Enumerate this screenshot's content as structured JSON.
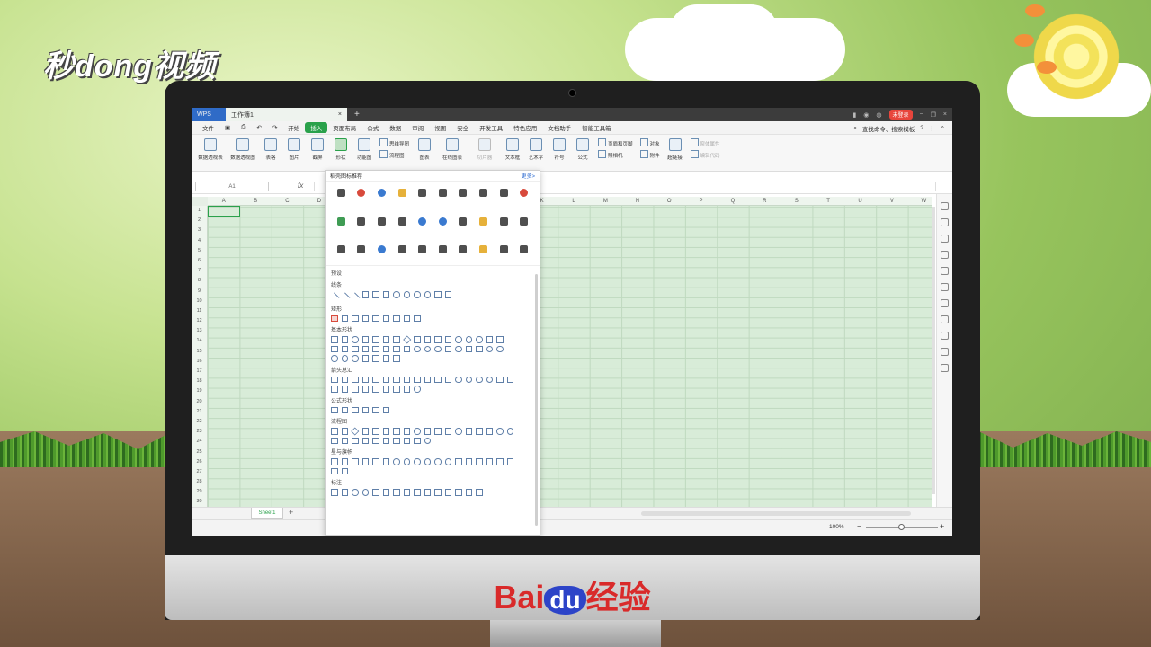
{
  "overlay": {
    "logo_text": "秒dong视频",
    "footer_brand_left": "Bai",
    "footer_brand_mid": "du",
    "footer_brand_right": "经验"
  },
  "window": {
    "app_tab": "WPS",
    "doc_tab": "工作簿1",
    "close_tab": "×",
    "new_tab": "+",
    "login_label": "未登录"
  },
  "menu": {
    "file": "文件",
    "items": [
      "开始",
      "插入",
      "页面布局",
      "公式",
      "数据",
      "审阅",
      "视图",
      "安全",
      "开发工具",
      "特色应用",
      "文档助手",
      "智能工具箱"
    ],
    "active_index": 1,
    "search_placeholder": "查找命令、搜索模板"
  },
  "ribbon": {
    "buttons": [
      "数据透视表",
      "数据透视图",
      "表格",
      "图片",
      "截屏",
      "形状",
      "功能图"
    ],
    "col1": [
      "思维导图",
      "流程图"
    ],
    "col2": [
      "图表",
      "在线图表"
    ],
    "disabled_label": "切片器",
    "text_buttons": [
      "文本框",
      "艺术字",
      "符号",
      "公式"
    ],
    "col3": [
      "页眉和页脚",
      "照相机"
    ],
    "col4": [
      "对象",
      "附件"
    ],
    "link": "超链接",
    "col5": [
      "窗体属性",
      "编辑代码"
    ]
  },
  "formula_bar": {
    "name_box": "A1",
    "fx": "fx"
  },
  "grid": {
    "columns": [
      "A",
      "B",
      "C",
      "D",
      "E",
      "F",
      "G",
      "H",
      "I",
      "J",
      "K",
      "L",
      "M",
      "N",
      "O",
      "P",
      "Q",
      "R",
      "S",
      "T",
      "U",
      "V",
      "W"
    ],
    "rows": [
      "1",
      "2",
      "3",
      "4",
      "5",
      "6",
      "7",
      "8",
      "9",
      "10",
      "11",
      "12",
      "13",
      "14",
      "15",
      "16",
      "17",
      "18",
      "19",
      "20",
      "21",
      "22",
      "23",
      "24",
      "25",
      "26",
      "27",
      "28",
      "29",
      "30"
    ]
  },
  "sheet": {
    "tab": "Sheet1",
    "add": "+"
  },
  "status": {
    "zoom": "100%",
    "minus": "−",
    "plus": "+"
  },
  "shapes_panel": {
    "header": "稻壳图标推荐",
    "more": "更多>",
    "presets": "预设",
    "categories": [
      "线条",
      "矩形",
      "基本形状",
      "箭头总汇",
      "公式形状",
      "流程图",
      "星与旗帜",
      "标注"
    ]
  }
}
